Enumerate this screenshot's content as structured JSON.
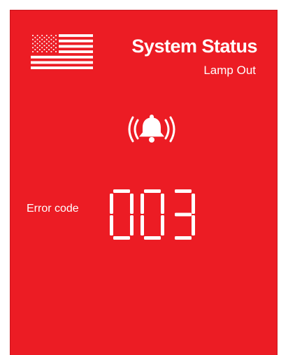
{
  "status": {
    "title": "System Status",
    "message": "Lamp Out",
    "error_label": "Error code",
    "error_code": "003"
  },
  "icons": {
    "flag": "us-flag-icon",
    "alarm": "ringing-bell-icon"
  },
  "colors": {
    "background": "#ec1c24",
    "foreground": "#ffffff"
  }
}
